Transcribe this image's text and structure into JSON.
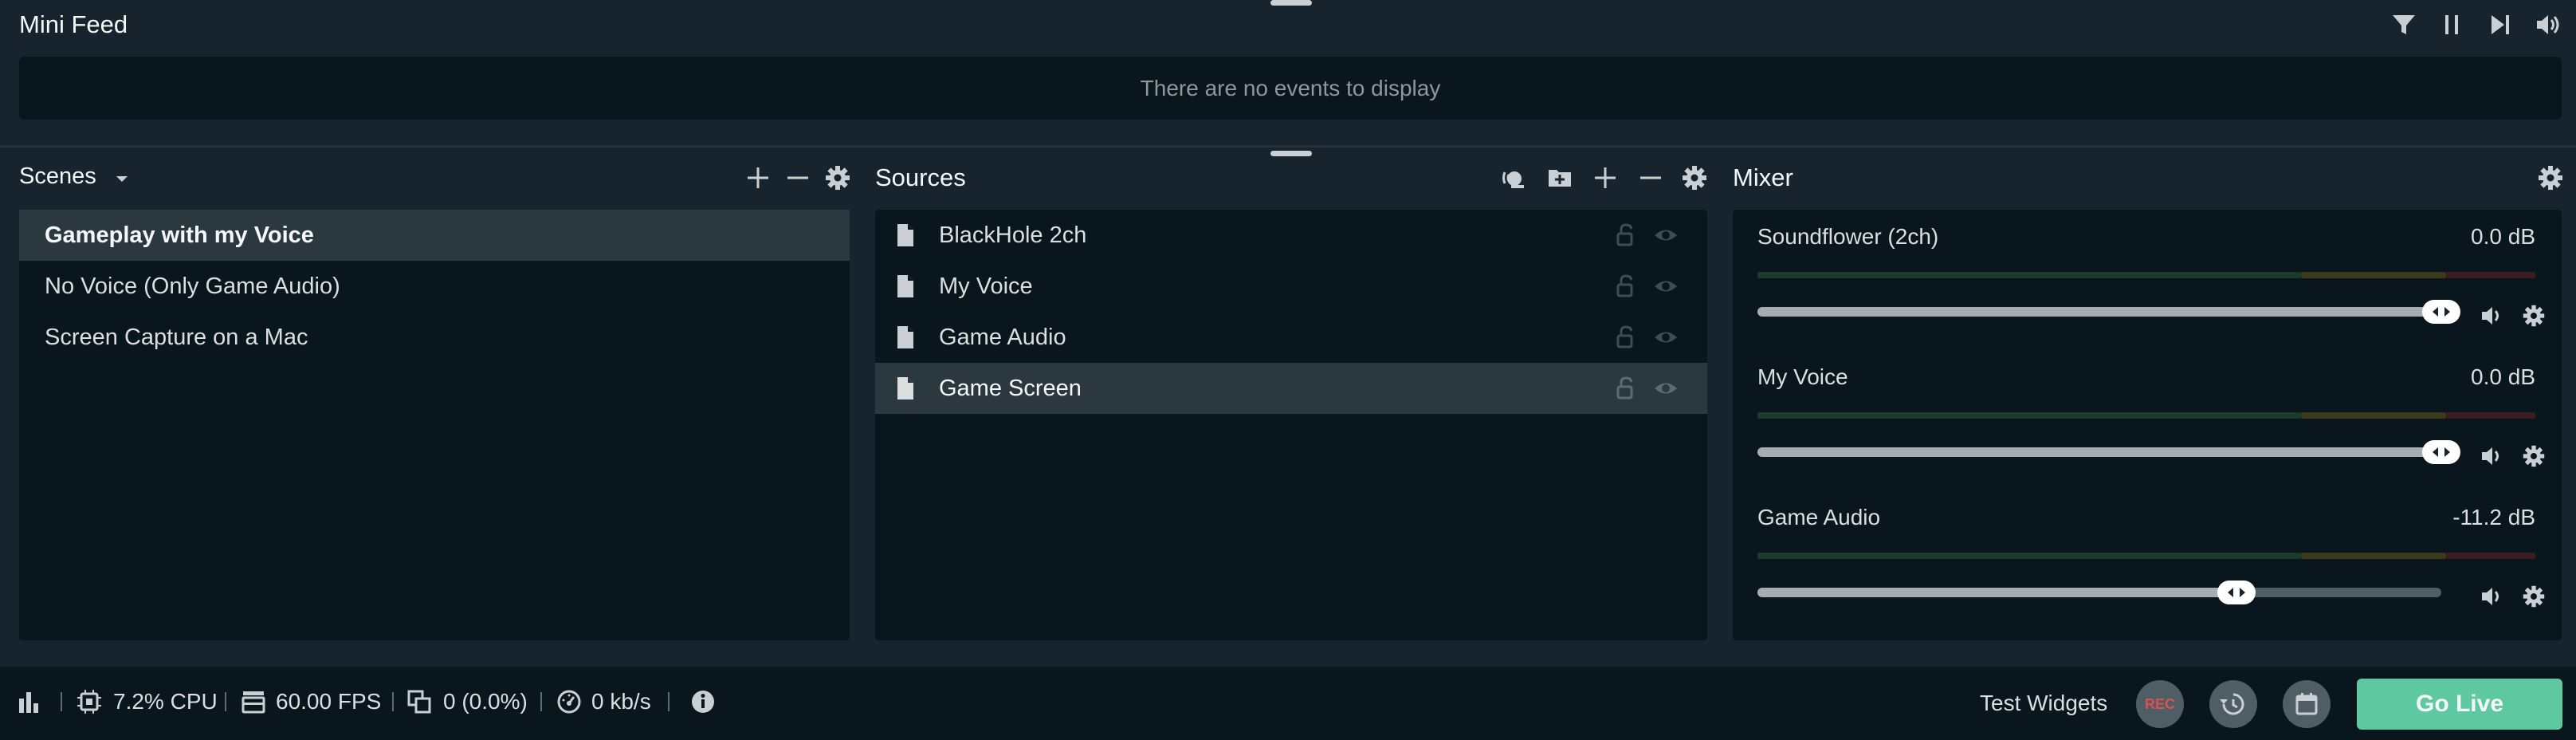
{
  "mini_feed": {
    "title": "Mini Feed",
    "empty_text": "There are no events to display",
    "icons": [
      "filter-icon",
      "pause-icon",
      "skip-icon",
      "volume-icon"
    ]
  },
  "scenes": {
    "title": "Scenes",
    "items": [
      {
        "label": "Gameplay with my Voice",
        "selected": true
      },
      {
        "label": "No Voice (Only Game Audio)",
        "selected": false
      },
      {
        "label": "Screen Capture on a Mac",
        "selected": false
      }
    ]
  },
  "sources": {
    "title": "Sources",
    "items": [
      {
        "label": "BlackHole 2ch",
        "selected": false
      },
      {
        "label": "My Voice",
        "selected": false
      },
      {
        "label": "Game Audio",
        "selected": false
      },
      {
        "label": "Game Screen",
        "selected": true
      }
    ]
  },
  "mixer": {
    "title": "Mixer",
    "channels": [
      {
        "name": "Soundflower (2ch)",
        "db": "0.0 dB",
        "level": 1.0
      },
      {
        "name": "My Voice",
        "db": "0.0 dB",
        "level": 1.0
      },
      {
        "name": "Game Audio",
        "db": "-11.2 dB",
        "level": 0.7
      }
    ]
  },
  "footer": {
    "cpu": "7.2% CPU",
    "fps": "60.00 FPS",
    "dropped": "0 (0.0%)",
    "bandwidth": "0 kb/s",
    "test_widgets": "Test Widgets",
    "rec": "REC",
    "go_live": "Go Live"
  },
  "colors": {
    "background": "#17242d",
    "panel": "#09161d",
    "selected_row": "#2b383f",
    "go_live": "#5ec8a0",
    "rec_text": "#d9534f"
  }
}
